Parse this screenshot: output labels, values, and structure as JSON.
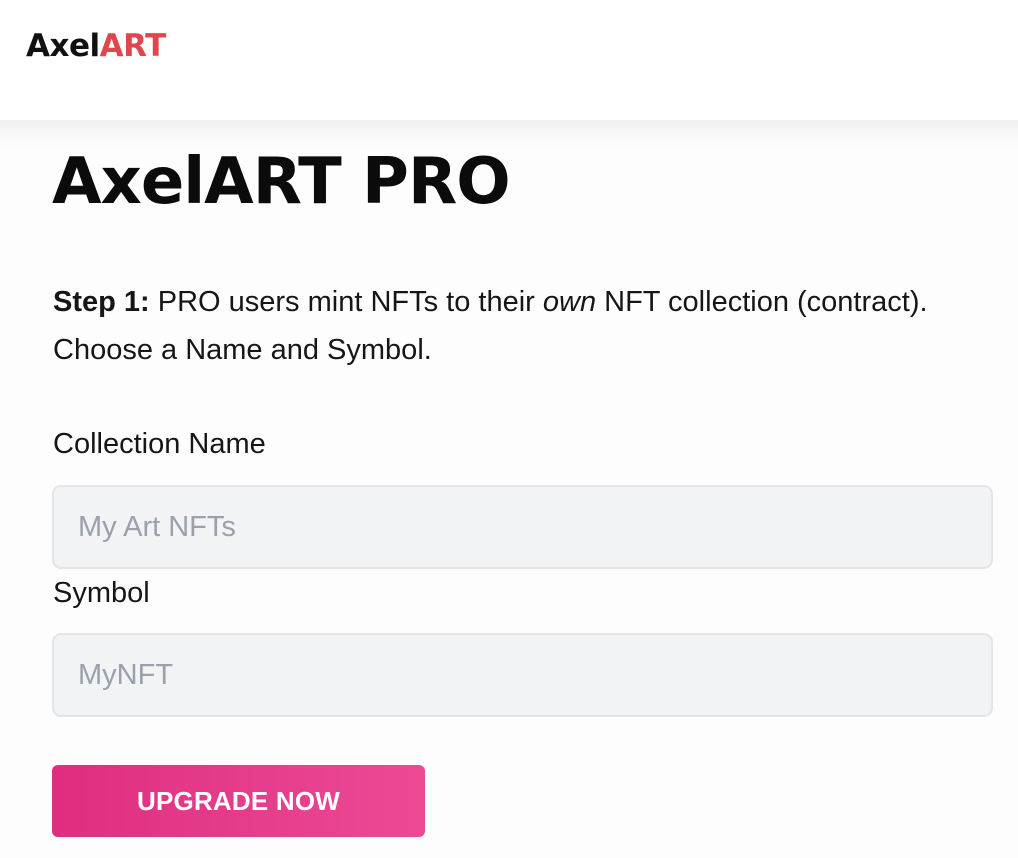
{
  "header": {
    "logo_part1": "Axel",
    "logo_part2": "ART"
  },
  "main": {
    "title": "AxelART PRO",
    "step_label": "Step 1:",
    "intro_before_em": " PRO users mint NFTs to their ",
    "intro_em": "own",
    "intro_after_em": " NFT collection (contract). Choose a Name and Symbol.",
    "collection_name": {
      "label": "Collection Name",
      "value": "",
      "placeholder": "My Art NFTs"
    },
    "symbol": {
      "label": "Symbol",
      "value": "",
      "placeholder": "MyNFT"
    },
    "cta_label": "UPGRADE NOW"
  },
  "colors": {
    "brand_accent": "#e0474c",
    "cta_pink": "#df2d80",
    "input_bg": "#f2f3f5",
    "placeholder": "#9aa1ad"
  }
}
